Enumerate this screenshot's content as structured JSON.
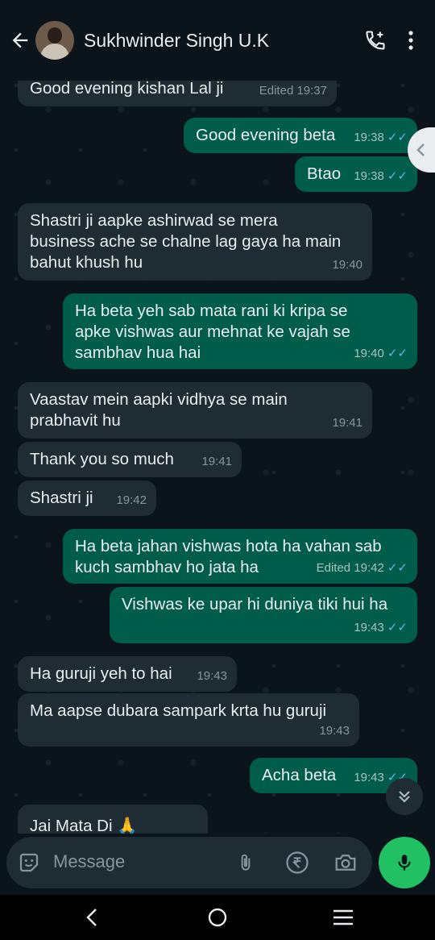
{
  "header": {
    "contact_name": "Sukhwinder Singh U.K",
    "icons": [
      "back-arrow-icon",
      "avatar",
      "add-call-icon",
      "more-options-icon"
    ]
  },
  "messages": [
    {
      "dir": "in",
      "text": "Good evening kishan Lal ji",
      "time": "Edited 19:37"
    },
    {
      "dir": "out",
      "text": "Good evening beta",
      "time": "19:38",
      "ticks": "✓✓"
    },
    {
      "dir": "out",
      "text": "Btao",
      "time": "19:38",
      "ticks": "✓✓"
    },
    {
      "dir": "in",
      "text": "Shastri ji aapke ashirwad se mera\nbusiness ache se chalne lag gaya ha main\nbahut khush hu",
      "time": "19:40"
    },
    {
      "dir": "out",
      "text": "Ha beta yeh sab mata rani ki kripa se\napke vishwas aur mehnat ke vajah se\nsambhav hua hai",
      "time": "19:40",
      "ticks": "✓✓"
    },
    {
      "dir": "in",
      "text": "Vaastav mein aapki vidhya se main\nprabhavit hu",
      "time": "19:41"
    },
    {
      "dir": "in",
      "text": "Thank you so much",
      "time": "19:41"
    },
    {
      "dir": "in",
      "text": "Shastri ji",
      "time": "19:42"
    },
    {
      "dir": "out",
      "text": "Ha beta jahan vishwas hota ha vahan sab\nkuch sambhav ho jata ha",
      "time": "Edited 19:42",
      "ticks": "✓✓"
    },
    {
      "dir": "out",
      "text": "Vishwas ke upar hi duniya tiki hui ha",
      "time": "19:43",
      "ticks": "✓✓"
    },
    {
      "dir": "in",
      "text": "Ha guruji yeh to hai",
      "time": "19:43"
    },
    {
      "dir": "in",
      "text": "Ma aapse dubara sampark krta hu guruji",
      "time": "19:43"
    },
    {
      "dir": "out",
      "text": "Acha beta",
      "time": "19:43",
      "ticks": "✓✓"
    },
    {
      "dir": "in",
      "text": "Jai Mata Di 🙏",
      "time": ""
    }
  ],
  "composer": {
    "placeholder": "Message",
    "icons": [
      "sticker-icon",
      "attach-icon",
      "rupee-payment-icon",
      "camera-icon",
      "mic-icon"
    ]
  },
  "colors": {
    "background": "#0b141a",
    "incoming_bubble": "#202c33",
    "outgoing_bubble": "#005c4b",
    "read_ticks": "#53bdeb",
    "mic_button": "#21c063"
  }
}
